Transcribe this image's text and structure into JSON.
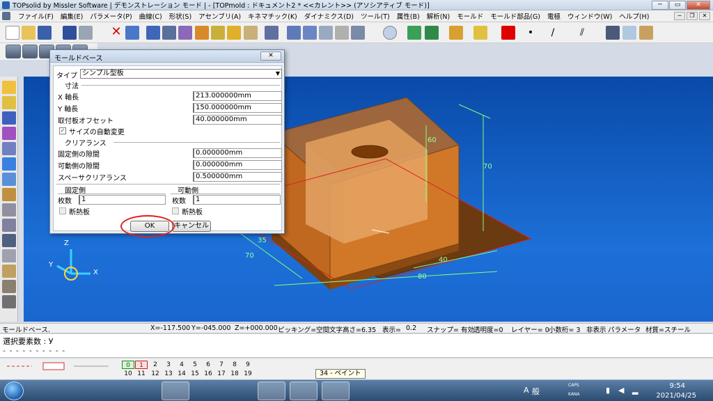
{
  "window": {
    "title": "TOPsolid by Missler Software | デモンストレーション モード | - [TOPmold : ドキュメント2 *  <<カレント>> (アソシアティブ モード)]",
    "min": "─",
    "max": "▭",
    "close": "✕"
  },
  "menu": {
    "items": [
      "ファイル(F)",
      "編集(E)",
      "パラメータ(P)",
      "曲線(C)",
      "形状(S)",
      "アセンブリ(A)",
      "キネマチック(K)",
      "ダイナミクス(D)",
      "ツール(T)",
      "属性(B)",
      "解析(N)",
      "モールド",
      "モールド部品(G)",
      "電極",
      "ウィンドウ(W)",
      "ヘルプ(H)"
    ]
  },
  "colors": {
    "current_color": "#e00000",
    "viewport_top": "#0a4aa8",
    "dim_green": "#7dff7d"
  },
  "dialog": {
    "title": "モールドベース",
    "close": "✕",
    "type_label": "タイプ",
    "type_value": "シンプル型板",
    "dim_group": "寸法",
    "x_label": "X 軸長",
    "x_value": "213.000000mm",
    "y_label": "Y 軸長",
    "y_value": "150.000000mm",
    "offset_label": "取付板オフセット",
    "offset_value": "40.000000mm",
    "auto_resize_label": "サイズの自動変更",
    "auto_resize_checked": true,
    "clearance_group": "クリアランス",
    "fixed_gap_label": "固定側の隙間",
    "fixed_gap_value": "0.000000mm",
    "moving_gap_label": "可動側の隙間",
    "moving_gap_value": "0.000000mm",
    "spacer_label": "スペーサクリアランス",
    "spacer_value": "0.500000mm",
    "fixed_side": {
      "label": "固定側",
      "count_label": "枚数",
      "count_value": "1",
      "insulation_label": "断熱板",
      "insulation_checked": false
    },
    "moving_side": {
      "label": "可動側",
      "count_label": "枚数",
      "count_value": "1",
      "insulation_label": "断熱板",
      "insulation_checked": false
    },
    "ok": "OK",
    "cancel": "キャンセル"
  },
  "viewport": {
    "dims": [
      "60",
      "70",
      "35",
      "70",
      "40",
      "80"
    ],
    "axis_z": "Z",
    "axis_y": "Y",
    "axis_x": "X"
  },
  "status": {
    "mode": "モールドベース.",
    "x": "X=-117.500",
    "y": "Y=-045.000",
    "z": "Z=+000.000",
    "picking": "ピッキング=空間",
    "text_height": "文字高さ=6.35",
    "display_label": "表示=",
    "display_value": "0.2",
    "snap": "スナップ= 有効",
    "transparency": "透明度=0",
    "layer": "レイヤー=  0",
    "decimals": "小数桁= 3",
    "hidden": "非表示",
    "param": "パラメータ",
    "material": "材質=スチール"
  },
  "command": {
    "prompt": "選択要素数 : У",
    "dashes": "- - - - - - - - - -"
  },
  "layers": {
    "row1": [
      "0",
      "1",
      "2",
      "3",
      "4",
      "5",
      "6",
      "7",
      "8",
      "9"
    ],
    "row2": [
      "10",
      "11",
      "12",
      "13",
      "14",
      "15",
      "16",
      "17",
      "18",
      "19"
    ]
  },
  "tooltip": "34 - ペイント",
  "taskbar": {
    "ime_a": "A",
    "ime_mode": "般",
    "caps": "CAPS",
    "kana": "KANA",
    "time": "9:54",
    "date": "2021/04/25"
  }
}
